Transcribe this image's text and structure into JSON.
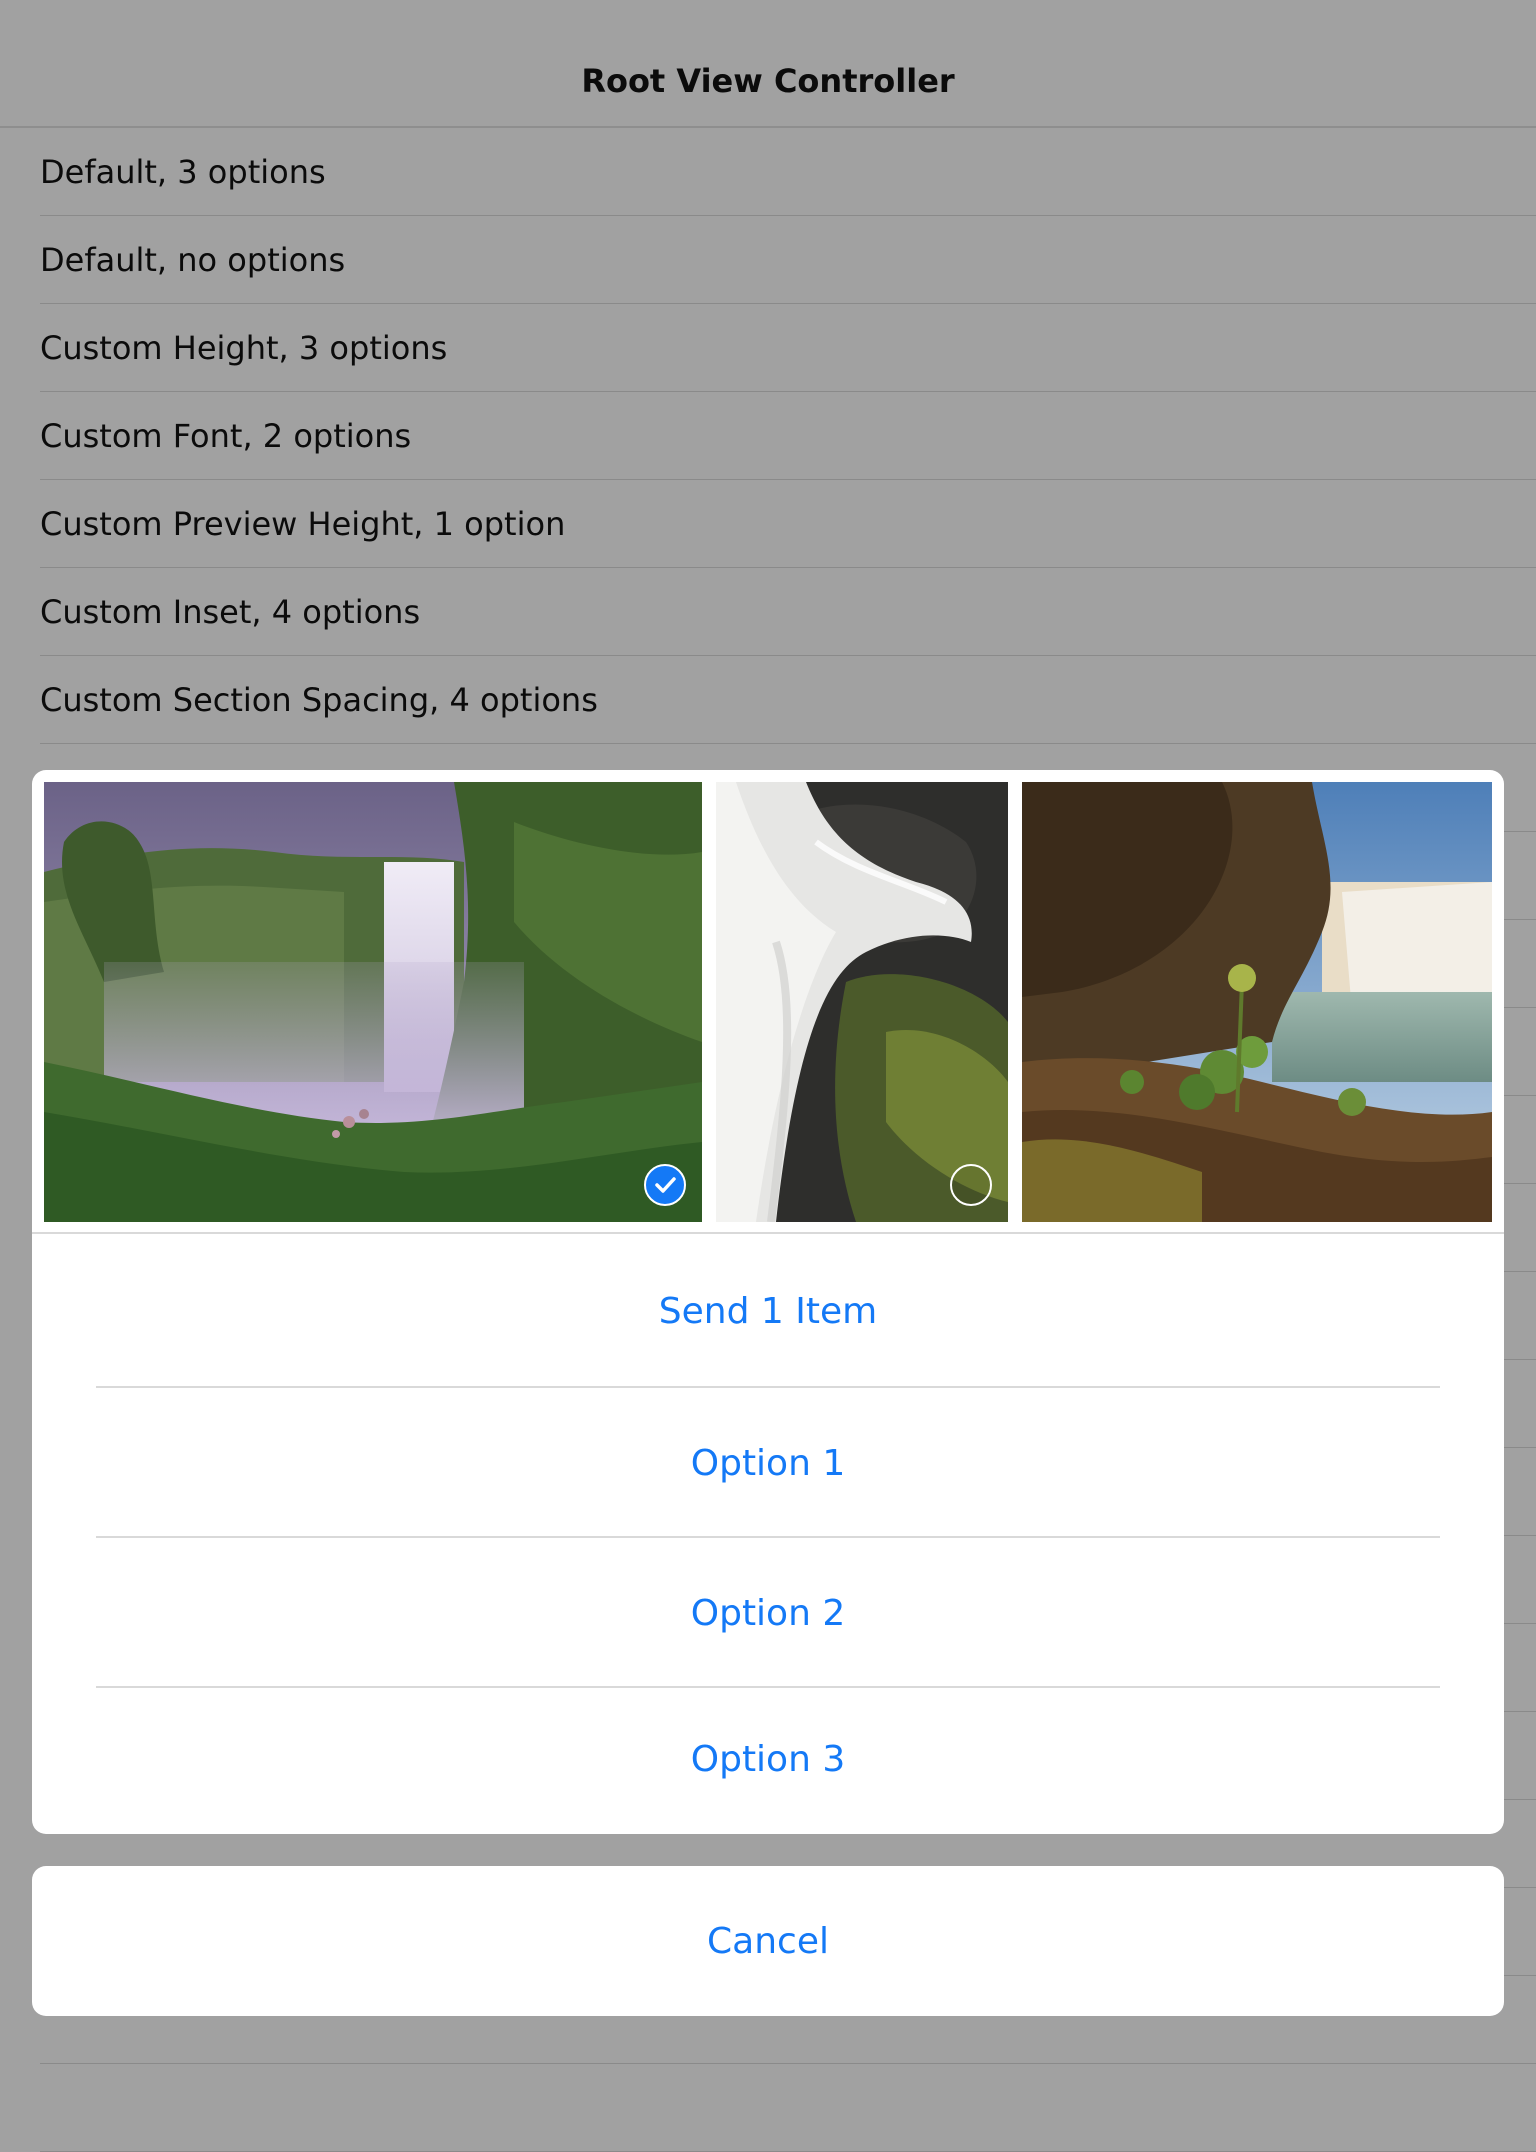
{
  "nav": {
    "title": "Root View Controller"
  },
  "table": {
    "rows": [
      {
        "label": "Default, 3 options"
      },
      {
        "label": "Default, no options"
      },
      {
        "label": "Custom Height, 3 options"
      },
      {
        "label": "Custom Font, 2 options"
      },
      {
        "label": "Custom Preview Height, 1 option"
      },
      {
        "label": "Custom Inset, 4 options"
      },
      {
        "label": "Custom Section Spacing, 4 options"
      }
    ]
  },
  "action_sheet": {
    "photos": [
      {
        "subject": "waterfall in green valley under purple sky",
        "selected": true
      },
      {
        "subject": "long-exposure cascade over mossy rocks",
        "selected": false
      },
      {
        "subject": "waterfall behind rocky cliff with wild plant",
        "selected": false
      }
    ],
    "send_label": "Send 1 Item",
    "options": [
      {
        "label": "Option 1"
      },
      {
        "label": "Option 2"
      },
      {
        "label": "Option 3"
      }
    ],
    "cancel_label": "Cancel"
  },
  "colors": {
    "accent": "#1479f6",
    "dim_background": "#a1a1a1",
    "sheet_background": "#ffffff",
    "separator": "#d9d9d9"
  },
  "icons": {
    "selected": "checkmark-circle-filled-icon",
    "unselected": "empty-circle-icon"
  }
}
